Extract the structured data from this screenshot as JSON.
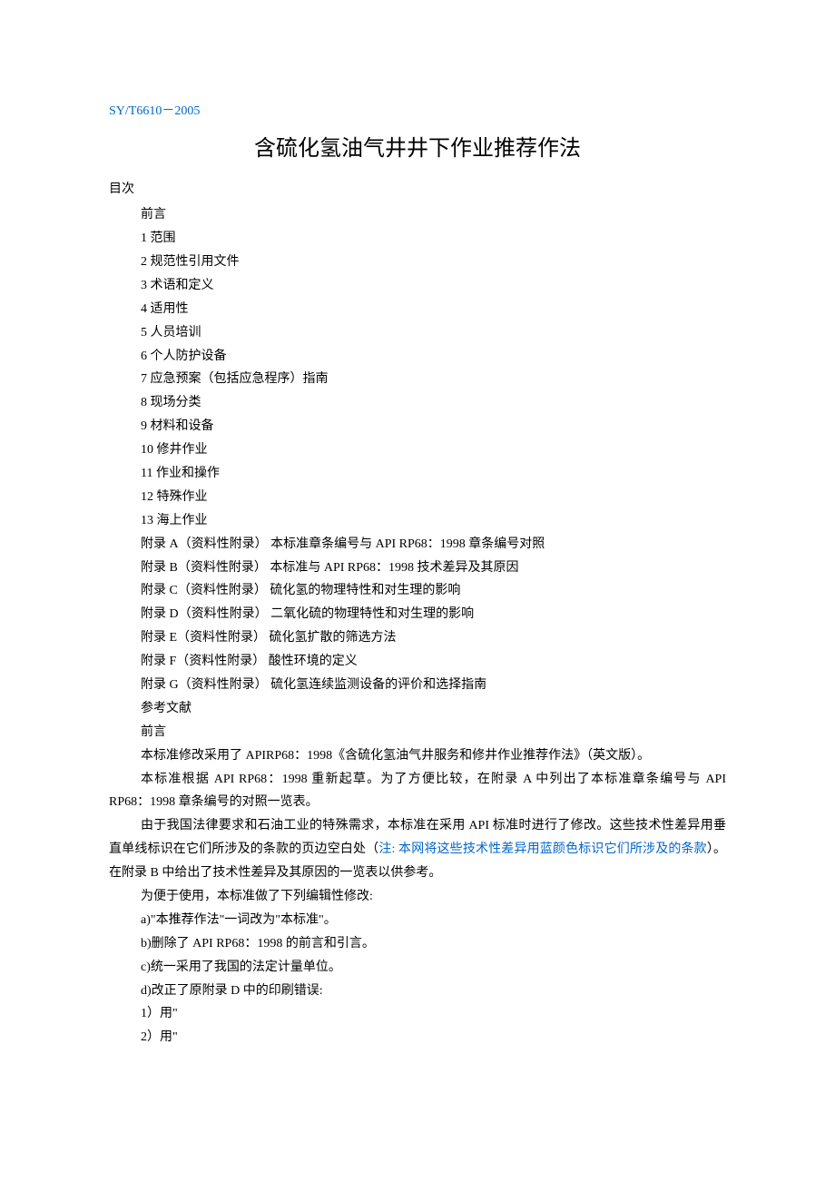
{
  "std_code": "SY/T6610－2005",
  "title": "含硫化氢油气井井下作业推荐作法",
  "toc_label": "目次",
  "toc": [
    "前言",
    "1 范围",
    "2 规范性引用文件",
    "3 术语和定义",
    "4 适用性",
    "5 人员培训",
    "6 个人防护设备",
    "7 应急预案（包括应急程序）指南",
    "8 现场分类",
    "9 材料和设备",
    "10 修井作业",
    "11 作业和操作",
    "12 特殊作业",
    "13 海上作业",
    "附录 A（资料性附录）  本标准章条编号与 API RP68：1998 章条编号对照",
    "附录 B（资料性附录）  本标准与 API RP68：1998 技术差异及其原因",
    "附录 C（资料性附录）  硫化氢的物理特性和对生理的影响",
    "附录 D（资料性附录）  二氧化硫的物理特性和对生理的影响",
    "附录 E（资料性附录）  硫化氢扩散的筛选方法",
    "附录 F（资料性附录）  酸性环境的定义",
    "附录 G（资料性附录）  硫化氢连续监测设备的评价和选择指南",
    "参考文献",
    "前言"
  ],
  "paragraphs": {
    "p1": "本标准修改采用了 APIRP68：1998《含硫化氢油气井服务和修井作业推荐作法》（英文版）。",
    "p2": "本标准根据 API RP68：1998 重新起草。为了方便比较，在附录 A 中列出了本标准章条编号与 API RP68：1998 章条编号的对照一览表。",
    "p3_before": "由于我国法律要求和石油工业的特殊需求，本标准在采用 API 标准时进行了修改。这些技术性差异用垂直单线标识在它们所涉及的条款的页边空白处（",
    "p3_note": "注: 本网将这些技术性差异用蓝颜色标识它们所涉及的条款",
    "p3_after": "）。在附录 B 中给出了技术性差异及其原因的一览表以供参考。",
    "p4": "为便于使用，本标准做了下列编辑性修改:",
    "items": [
      "a)\"本推荐作法\"一词改为\"本标准\"。",
      "b)删除了 API RP68：1998 的前言和引言。",
      "c)统一采用了我国的法定计量单位。",
      "d)改正了原附录 D 中的印刷错误:",
      "1）用\"",
      "2）用\""
    ]
  }
}
